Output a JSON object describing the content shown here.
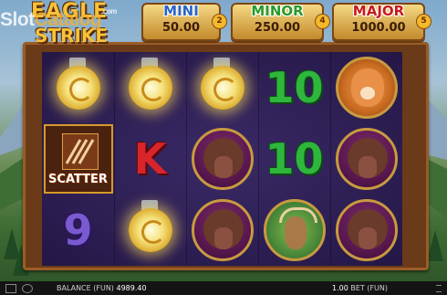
{
  "watermark": {
    "slot": "Slot",
    "catalog": "Catalog",
    "com": ".com"
  },
  "logo": {
    "line1": "EAGLE",
    "line2": "STRIKE"
  },
  "jackpots": [
    {
      "name": "MINI",
      "value": "50.00",
      "badge": "2",
      "color": "#2a63c8"
    },
    {
      "name": "MINOR",
      "value": "250.00",
      "badge": "4",
      "color": "#2a9a2a"
    },
    {
      "name": "MAJOR",
      "value": "1000.00",
      "badge": "5",
      "color": "#c81a1a"
    }
  ],
  "reels": {
    "col1": [
      {
        "sym": "coin-sparkle"
      },
      {
        "sym": "scatter",
        "label": "SCATTER"
      },
      {
        "sym": "nine",
        "label": "9"
      }
    ],
    "col2": [
      {
        "sym": "coin-sparkle"
      },
      {
        "sym": "king",
        "label": "K"
      },
      {
        "sym": "coin-sparkle"
      }
    ],
    "col3": [
      {
        "sym": "coin-sparkle"
      },
      {
        "sym": "bison"
      },
      {
        "sym": "bison"
      }
    ],
    "col4": [
      {
        "sym": "ten",
        "label": "10"
      },
      {
        "sym": "ten",
        "label": "10"
      },
      {
        "sym": "deer"
      }
    ],
    "col5": [
      {
        "sym": "puma"
      },
      {
        "sym": "bison"
      },
      {
        "sym": "bison"
      }
    ]
  },
  "bottom": {
    "balance_label": "BALANCE (FUN)",
    "balance_value": "4989.40",
    "bet_value": "1.00",
    "bet_label": "BET (FUN)"
  }
}
